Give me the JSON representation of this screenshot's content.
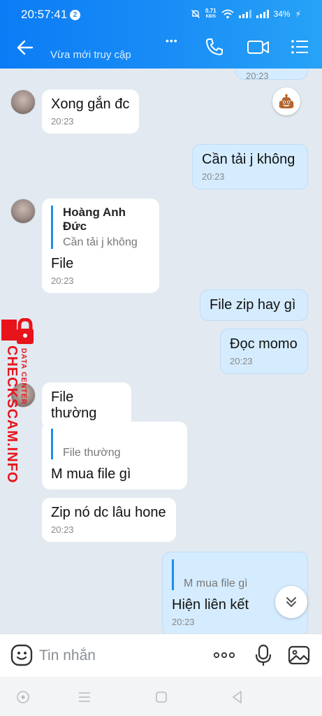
{
  "status_bar": {
    "time": "20:57:41",
    "notification_count": "2",
    "net_speed_value": "0.71",
    "net_speed_unit": "KB/S",
    "battery": "34%"
  },
  "header": {
    "subtitle": "Vừa mới truy cập",
    "menu_dots": "•••"
  },
  "colors": {
    "header_start": "#0b7cf5",
    "header_end": "#27a3f7",
    "outgoing_bubble": "#d5ecff",
    "incoming_bubble": "#ffffff",
    "chat_background": "#e2e9f1",
    "quote_bar": "#1b8ef0",
    "watermark": "#e8141b"
  },
  "messages": [
    {
      "time_only": "20:23"
    },
    {
      "text": "Xong gắn đc",
      "time": "20:23"
    },
    {
      "text": "Cần tải j không",
      "time": "20:23"
    },
    {
      "quote_author": "Hoàng Anh Đức",
      "quote_text": "Cần tải j không",
      "text": "File",
      "time": "20:23"
    },
    {
      "text": "File zip hay gì"
    },
    {
      "text": "Đọc momo",
      "time": "20:23"
    },
    {
      "text": "File thường"
    },
    {
      "quote_text": "File thường",
      "text": "M mua file gì"
    },
    {
      "text": "Zip nó dc lâu hone",
      "time": "20:23"
    },
    {
      "quote_text": "M mua file gì",
      "text": "Hiện liên kết",
      "time": "20:23"
    }
  ],
  "watermark": {
    "main": "CHECKSCAM.INFO",
    "sub": "DATA CENTER"
  },
  "input": {
    "placeholder": "Tin nhắn"
  },
  "icons": {
    "back": "arrow-left",
    "call": "phone",
    "video": "video-camera",
    "menu": "list",
    "reaction": "poop-emoji",
    "scroll_down": "double-chevron-down",
    "sticker": "smiley-sticker",
    "more": "ellipsis",
    "voice": "microphone",
    "image": "image"
  }
}
